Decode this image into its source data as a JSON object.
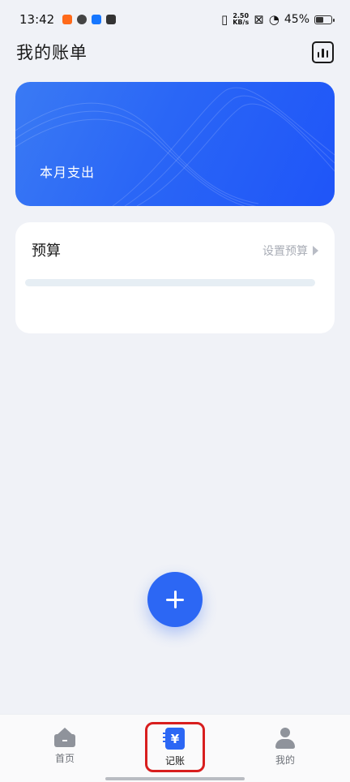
{
  "status_bar": {
    "time": "13:42",
    "net_speed_value": "2.50",
    "net_speed_unit": "KB/s",
    "battery": "45%"
  },
  "header": {
    "title": "我的账单",
    "stats_icon": "bar-chart-icon"
  },
  "expense_card": {
    "label": "本月支出",
    "accent": "#2a66f6"
  },
  "budget": {
    "title": "预算",
    "action": "设置预算",
    "progress": 0
  },
  "fab": {
    "icon": "plus-icon"
  },
  "tab_bar": {
    "items": [
      {
        "label": "首页",
        "icon": "home-icon",
        "active": false
      },
      {
        "label": "记账",
        "icon": "yen-book-icon",
        "glyph": "¥",
        "active": true
      },
      {
        "label": "我的",
        "icon": "person-icon",
        "active": false
      }
    ],
    "highlight_color": "#d81e1e"
  }
}
